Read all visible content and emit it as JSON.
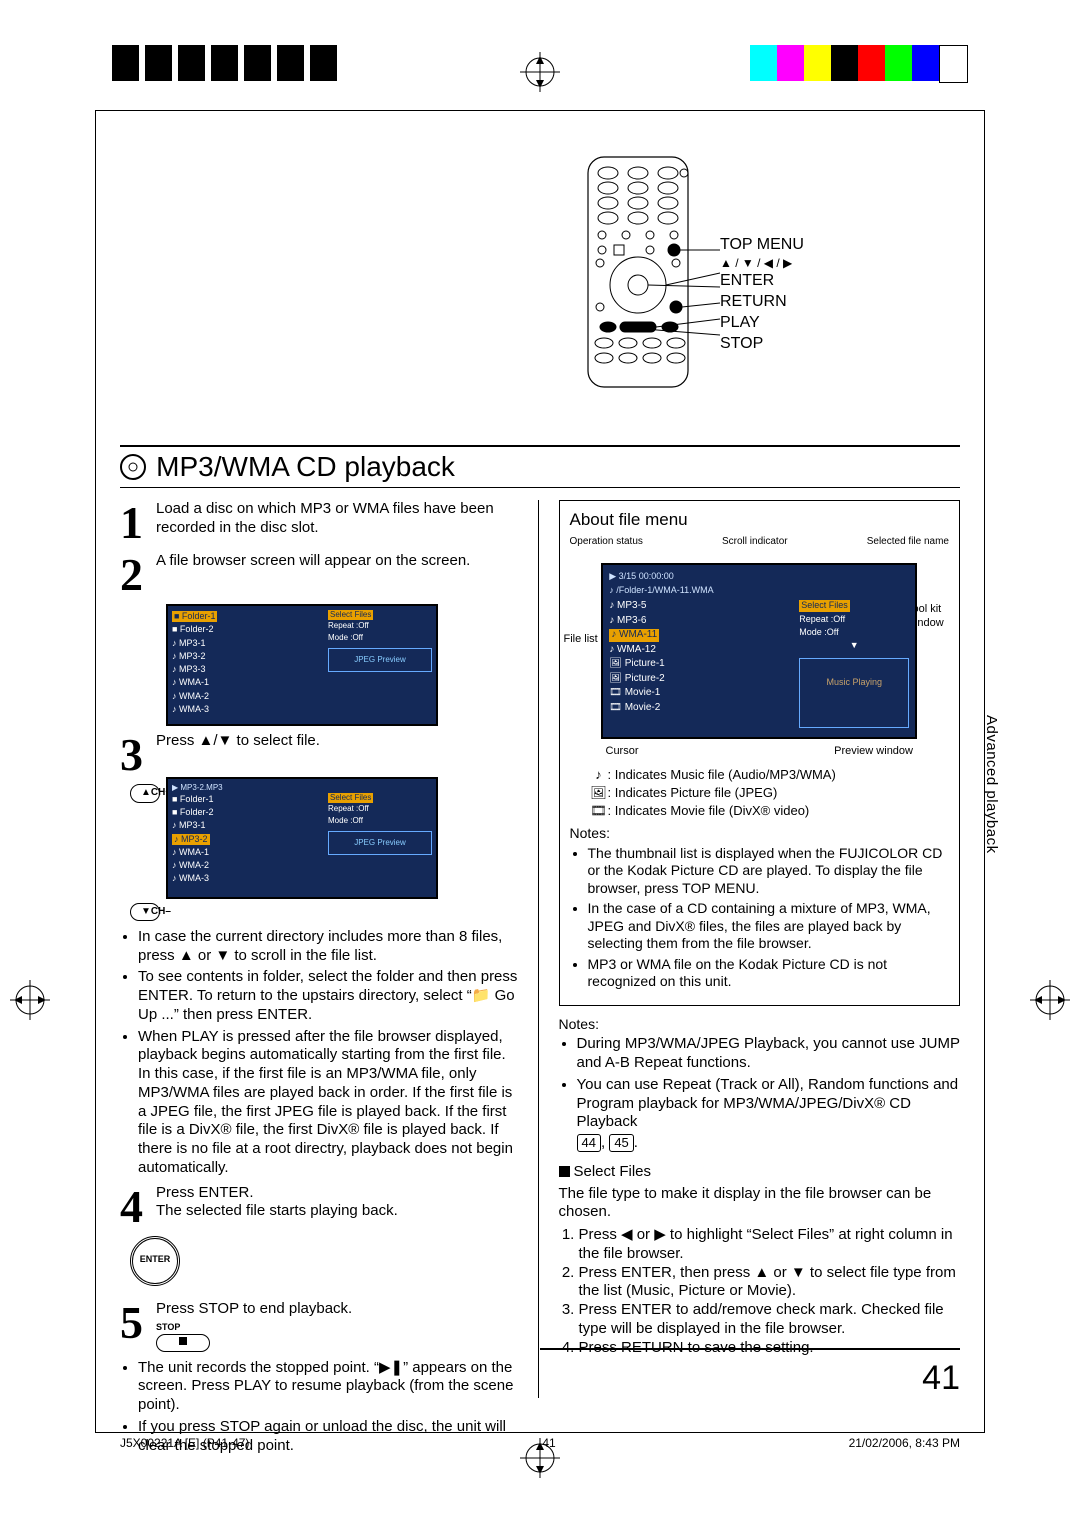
{
  "page_number": "41",
  "footer": {
    "docid": "J5X00221A [E] (P41-47)",
    "pg": "41",
    "datetime": "21/02/2006, 8:43 PM"
  },
  "side_tab": "Advanced playback",
  "remote_labels": {
    "top_menu": "TOP MENU",
    "arrows": "▲ / ▼ / ◀ / ▶",
    "enter": "ENTER",
    "return": "RETURN",
    "play": "PLAY",
    "stop": "STOP"
  },
  "section_title": "MP3/WMA CD playback",
  "steps": {
    "s1": {
      "num": "1",
      "text": "Load a disc on which MP3 or WMA files have been recorded in the disc slot."
    },
    "s2": {
      "num": "2",
      "text": "A file browser screen will appear on the screen."
    },
    "s3": {
      "num": "3",
      "text": "Press ▲/▼ to select file."
    },
    "s3_bullets": [
      "In case the current directory includes more than 8 files, press ▲ or ▼ to scroll in the file list.",
      "To see contents in folder, select the folder and then press ENTER. To return to the upstairs directory, select “📁 Go Up ...” then press ENTER.",
      "When PLAY is pressed after the file browser displayed, playback begins automatically starting from the first file. In this case, if the first file is an MP3/WMA file, only MP3/WMA files are played back in order. If the first file is a JPEG file, the first JPEG file is played back. If the first file is a DivX® file, the first DivX® file is played back. If there is no file at a root directry, playback does not begin automatically."
    ],
    "s4": {
      "num": "4",
      "text_a": "Press ENTER.",
      "text_b": "The selected file starts playing back."
    },
    "s5": {
      "num": "5",
      "text": "Press STOP to end playback.",
      "stop_label": "STOP"
    },
    "s5_bullets": [
      "The unit records the stopped point. “▶❚” appears on the screen. Press PLAY to resume playback (from the scene point).",
      "If you press STOP again or unload the disc, the unit will clear the stopped point."
    ],
    "ch_up": "▲CH+",
    "ch_dn": "▼CH–",
    "enter_btn": "ENTER"
  },
  "mini1": {
    "files": [
      "■ Folder-1",
      "■ Folder-2",
      "♪ MP3-1",
      "♪ MP3-2",
      "♪ MP3-3",
      "♪ WMA-1",
      "♪ WMA-2",
      "♪ WMA-3"
    ],
    "tool": {
      "select": "Select Files",
      "repeat": "Repeat  :Off",
      "mode": "Mode   :Off",
      "prev": "JPEG Preview"
    },
    "hl_index": 0
  },
  "mini2": {
    "top": "▶   MP3-2.MP3",
    "files": [
      "■ Folder-1",
      "■ Folder-2",
      "♪ MP3-1",
      "♪ MP3-2",
      "♪ WMA-1",
      "♪ WMA-2",
      "♪ WMA-3"
    ],
    "tool": {
      "select": "Select Files",
      "repeat": "Repeat  :Off",
      "mode": "Mode   :Off",
      "prev": "JPEG Preview"
    },
    "hl_index": 3
  },
  "filemenu": {
    "title": "About file menu",
    "lbl_op": "Operation status",
    "lbl_scroll": "Scroll indicator",
    "lbl_sel": "Selected file name",
    "lbl_filelist": "File list",
    "lbl_toolkit": "Tool kit window",
    "lbl_cursor": "Cursor",
    "lbl_preview": "Preview window",
    "top_a": "▶      3/15  00:00:00",
    "top_b": "♪ /Folder-1/WMA-11.WMA",
    "files": [
      "♪ MP3-5",
      "♪ MP3-6",
      "♪ WMA-11",
      "♪ WMA-12",
      "🖼 Picture-1",
      "🖼 Picture-2",
      "🎞 Movie-1",
      "🎞 Movie-2"
    ],
    "hl_index": 2,
    "tool": {
      "select": "Select Files",
      "repeat": "Repeat   :Off",
      "mode": "Mode     :Off",
      "prev": "Music Playing"
    },
    "legend": {
      "music": ": Indicates Music file (Audio/MP3/WMA)",
      "pic": ": Indicates Picture file (JPEG)",
      "mov": ": Indicates Movie file (DivX® video)"
    },
    "notes_h": "Notes:",
    "notes": [
      "The thumbnail list is displayed when the FUJICOLOR CD or the Kodak Picture CD are played. To display the file browser, press TOP MENU.",
      "In the case of a CD containing a mixture of MP3, WMA, JPEG and DivX® files, the files are played back by selecting them from the file browser.",
      "MP3 or WMA file on the Kodak Picture CD is not recognized on this unit."
    ]
  },
  "outer_notes": {
    "h": "Notes:",
    "items": [
      "During MP3/WMA/JPEG Playback, you cannot use JUMP and A-B Repeat functions.",
      "You can use Repeat (Track or All), Random functions and Program playback for MP3/WMA/JPEG/DivX® CD Playback"
    ],
    "refs": [
      "44",
      "45"
    ]
  },
  "select_files": {
    "h": "Select Files",
    "intro": "The file type to make it display in the file browser can be chosen.",
    "steps": [
      "Press ◀ or ▶ to highlight “Select Files” at right column in the file browser.",
      "Press ENTER, then press ▲ or ▼ to select file type from the list (Music, Picture or Movie).",
      "Press ENTER to add/remove check mark. Checked file type will be displayed in the file browser.",
      "Press RETURN to save the setting."
    ]
  }
}
